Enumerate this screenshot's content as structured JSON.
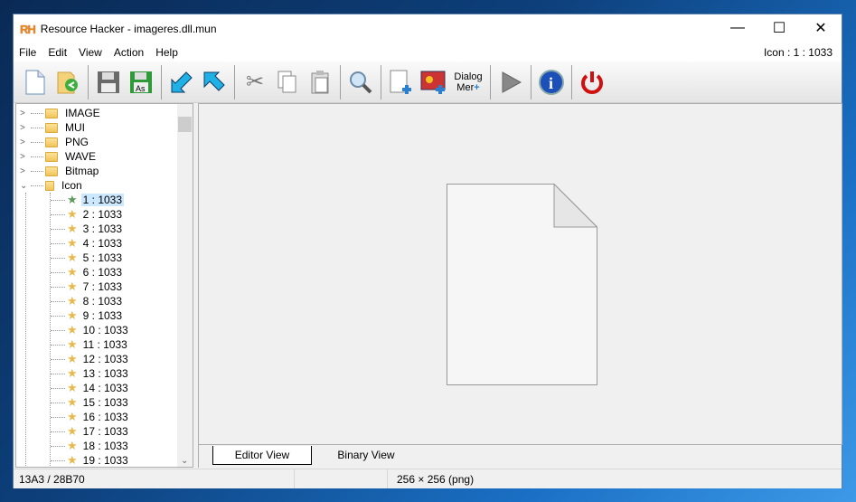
{
  "window": {
    "logo": "RH",
    "title": "Resource Hacker - imageres.dll.mun",
    "minimize": "—",
    "maximize": "☐",
    "close": "✕"
  },
  "menu": [
    "File",
    "Edit",
    "View",
    "Action",
    "Help"
  ],
  "current_resource": "Icon : 1 : 1033",
  "toolbar": {
    "dialog_menu_label_1": "Dialog",
    "dialog_menu_label_2": "Mer"
  },
  "tree": {
    "folders": [
      "IMAGE",
      "MUI",
      "PNG",
      "WAVE",
      "Bitmap"
    ],
    "open_folder": "Icon",
    "items": [
      "1 : 1033",
      "2 : 1033",
      "3 : 1033",
      "4 : 1033",
      "5 : 1033",
      "6 : 1033",
      "7 : 1033",
      "8 : 1033",
      "9 : 1033",
      "10 : 1033",
      "11 : 1033",
      "12 : 1033",
      "13 : 1033",
      "14 : 1033",
      "15 : 1033",
      "16 : 1033",
      "17 : 1033",
      "18 : 1033",
      "19 : 1033"
    ],
    "selected_index": 0
  },
  "tabs": {
    "editor": "Editor View",
    "binary": "Binary View"
  },
  "status": {
    "offset": "13A3 / 28B70",
    "middle": "",
    "info": "256 × 256 (png)"
  }
}
